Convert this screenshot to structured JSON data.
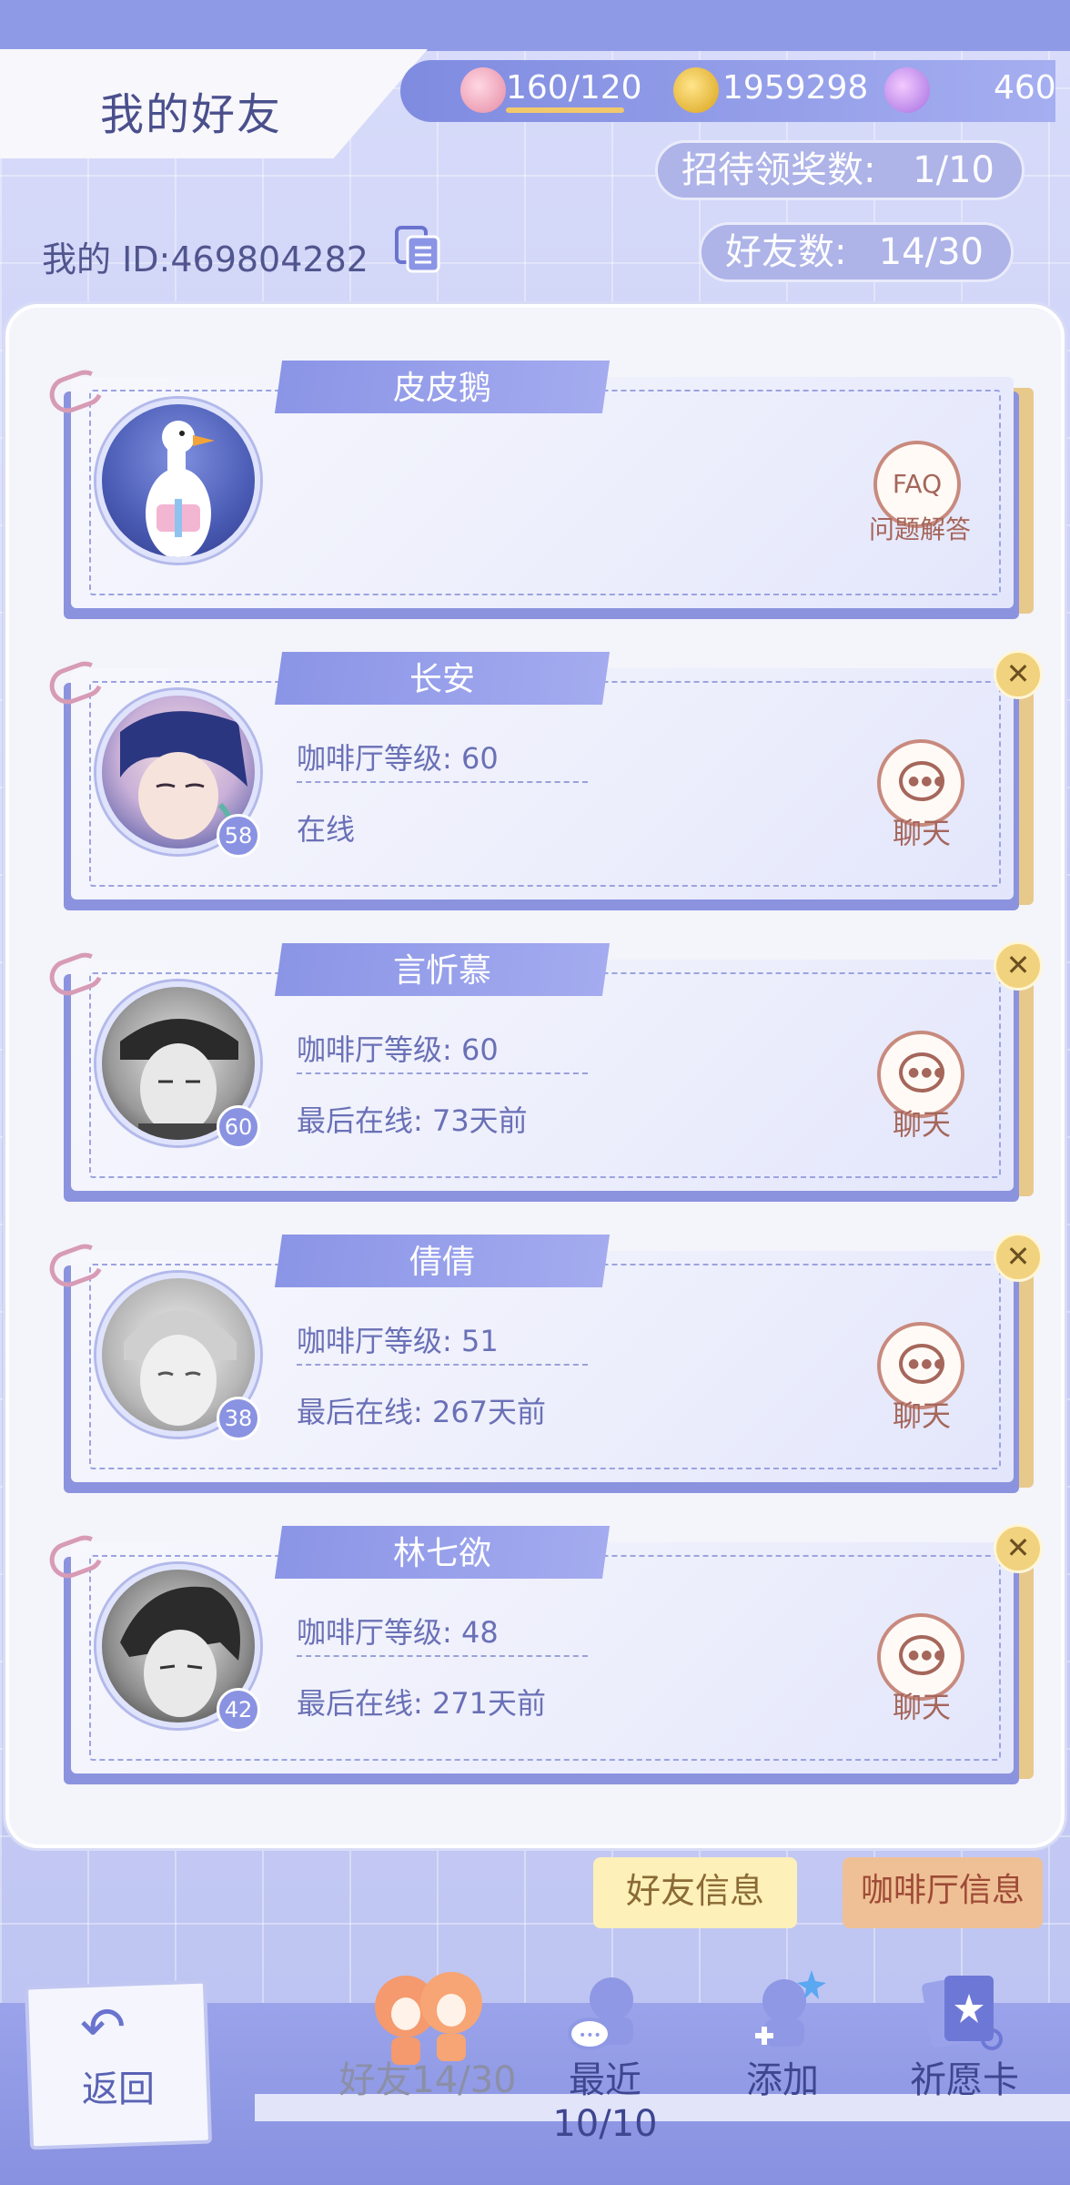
{
  "header": {
    "title": "我的好友",
    "resources": {
      "stamina": "160/120",
      "coins": "1959298",
      "gems": "460"
    }
  },
  "stats": {
    "reception_label": "招待领奖数:",
    "reception_value": "1/10",
    "friend_count_label": "好友数:",
    "friend_count_value": "14/30"
  },
  "my_id": "我的 ID:469804282",
  "friends": [
    {
      "name": "皮皮鹅",
      "faq": "FAQ",
      "faq_label": "问题解答"
    },
    {
      "name": "长安",
      "cafe_level": "咖啡厅等级: 60",
      "status": "在线",
      "level": "58",
      "chat": "聊天"
    },
    {
      "name": "言忻慕",
      "cafe_level": "咖啡厅等级: 60",
      "status": "最后在线: 73天前",
      "level": "60",
      "chat": "聊天"
    },
    {
      "name": "倩倩",
      "cafe_level": "咖啡厅等级: 51",
      "status": "最后在线: 267天前",
      "level": "38",
      "chat": "聊天"
    },
    {
      "name": "林七欲",
      "cafe_level": "咖啡厅等级: 48",
      "status": "最后在线: 271天前",
      "level": "42",
      "chat": "聊天"
    }
  ],
  "tabs": {
    "friend_info": "好友信息",
    "cafe_info": "咖啡厅信息"
  },
  "nav": {
    "back": "返回",
    "friends": "好友14/30",
    "recent": "最近10/10",
    "add": "添加",
    "wish": "祈愿卡"
  },
  "colors": {
    "accent": "#8b95e6",
    "chat": "#a5665b",
    "pin": "#f1d27e"
  }
}
